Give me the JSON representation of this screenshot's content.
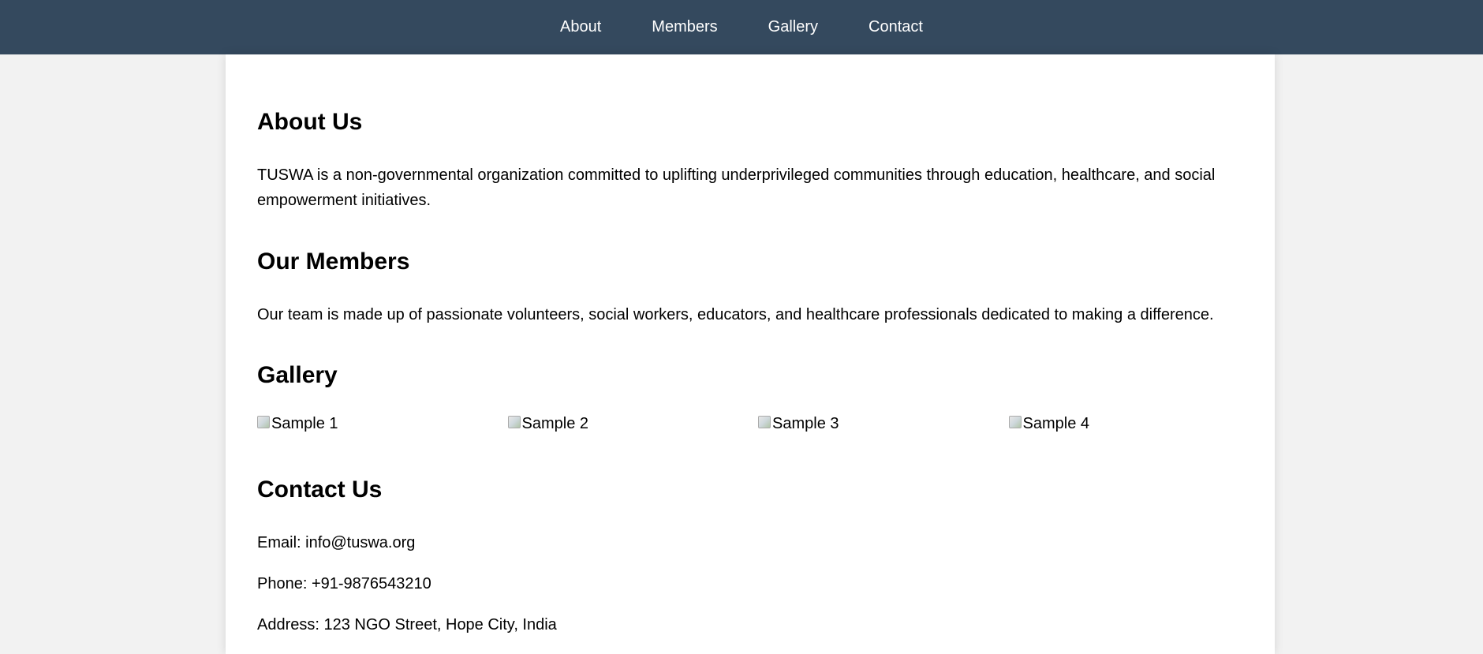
{
  "nav": {
    "items": [
      {
        "label": "About"
      },
      {
        "label": "Members"
      },
      {
        "label": "Gallery"
      },
      {
        "label": "Contact"
      }
    ]
  },
  "about": {
    "heading": "About Us",
    "text": "TUSWA is a non-governmental organization committed to uplifting underprivileged communities through education, healthcare, and social empowerment initiatives."
  },
  "members": {
    "heading": "Our Members",
    "text": "Our team is made up of passionate volunteers, social workers, educators, and healthcare professionals dedicated to making a difference."
  },
  "gallery": {
    "heading": "Gallery",
    "images": [
      {
        "alt": "Sample 1"
      },
      {
        "alt": "Sample 2"
      },
      {
        "alt": "Sample 3"
      },
      {
        "alt": "Sample 4"
      }
    ]
  },
  "contact": {
    "heading": "Contact Us",
    "email": "Email: info@tuswa.org",
    "phone": "Phone: +91-9876543210",
    "address": "Address: 123 NGO Street, Hope City, India"
  },
  "colors": {
    "navbar_bg": "#34495e",
    "page_bg": "#f2f2f2",
    "card_bg": "#ffffff"
  }
}
